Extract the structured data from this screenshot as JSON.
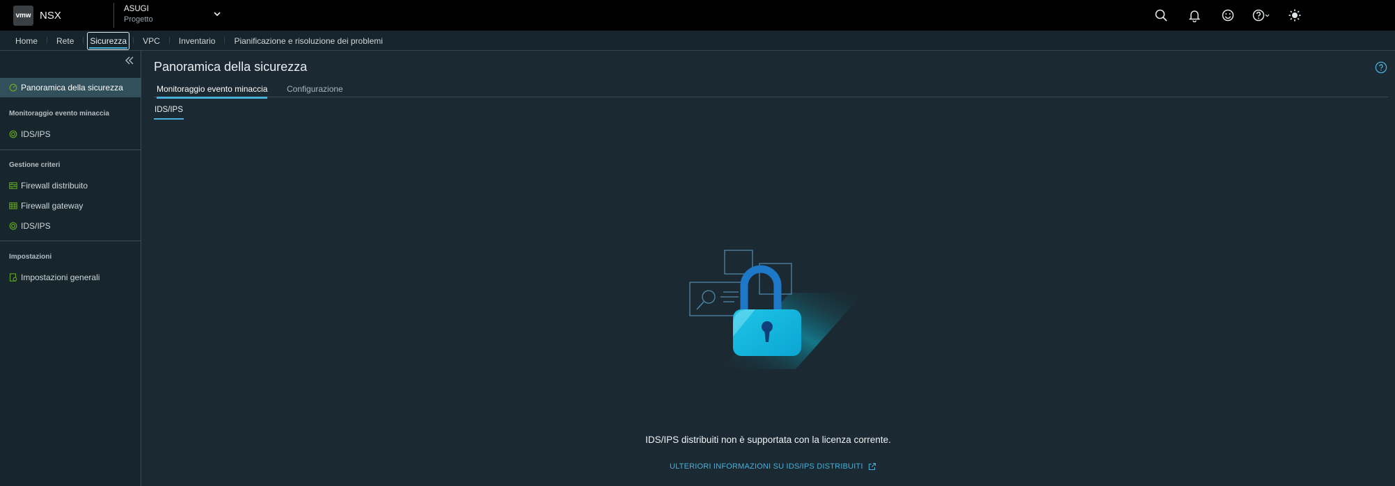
{
  "header": {
    "logo": "vmw",
    "app_name": "NSX",
    "context": {
      "name": "ASUGI",
      "type": "Progetto"
    },
    "icons": [
      "search-icon",
      "bell-icon",
      "smiley-icon",
      "help-icon",
      "sun-icon"
    ]
  },
  "topnav": {
    "items": [
      {
        "label": "Home"
      },
      {
        "label": "Rete"
      },
      {
        "label": "Sicurezza",
        "active": true
      },
      {
        "label": "VPC"
      },
      {
        "label": "Inventario"
      },
      {
        "label": "Pianificazione e risoluzione dei problemi"
      }
    ]
  },
  "sidebar": {
    "overview": "Panoramica della sicurezza",
    "section_threat": "Monitoraggio evento minaccia",
    "threat_ids": "IDS/IPS",
    "section_policy": "Gestione criteri",
    "dfw": "Firewall distribuito",
    "gfw": "Firewall gateway",
    "policy_ids": "IDS/IPS",
    "section_settings": "Impostazioni",
    "general_settings": "Impostazioni generali"
  },
  "main": {
    "title": "Panoramica della sicurezza",
    "tabs": [
      {
        "label": "Monitoraggio evento minaccia",
        "active": true
      },
      {
        "label": "Configurazione"
      }
    ],
    "subtab": "IDS/IPS",
    "message": "IDS/IPS distribuiti non è supportata con la licenza corrente.",
    "link": "ULTERIORI INFORMAZIONI SU IDS/IPS DISTRIBUITI"
  },
  "colors": {
    "accent": "#49afd9",
    "header_bg": "#000000",
    "content_bg": "#1b2a32",
    "sidebar_active": "#324f5c",
    "sidebar_icon": "#62a420"
  }
}
